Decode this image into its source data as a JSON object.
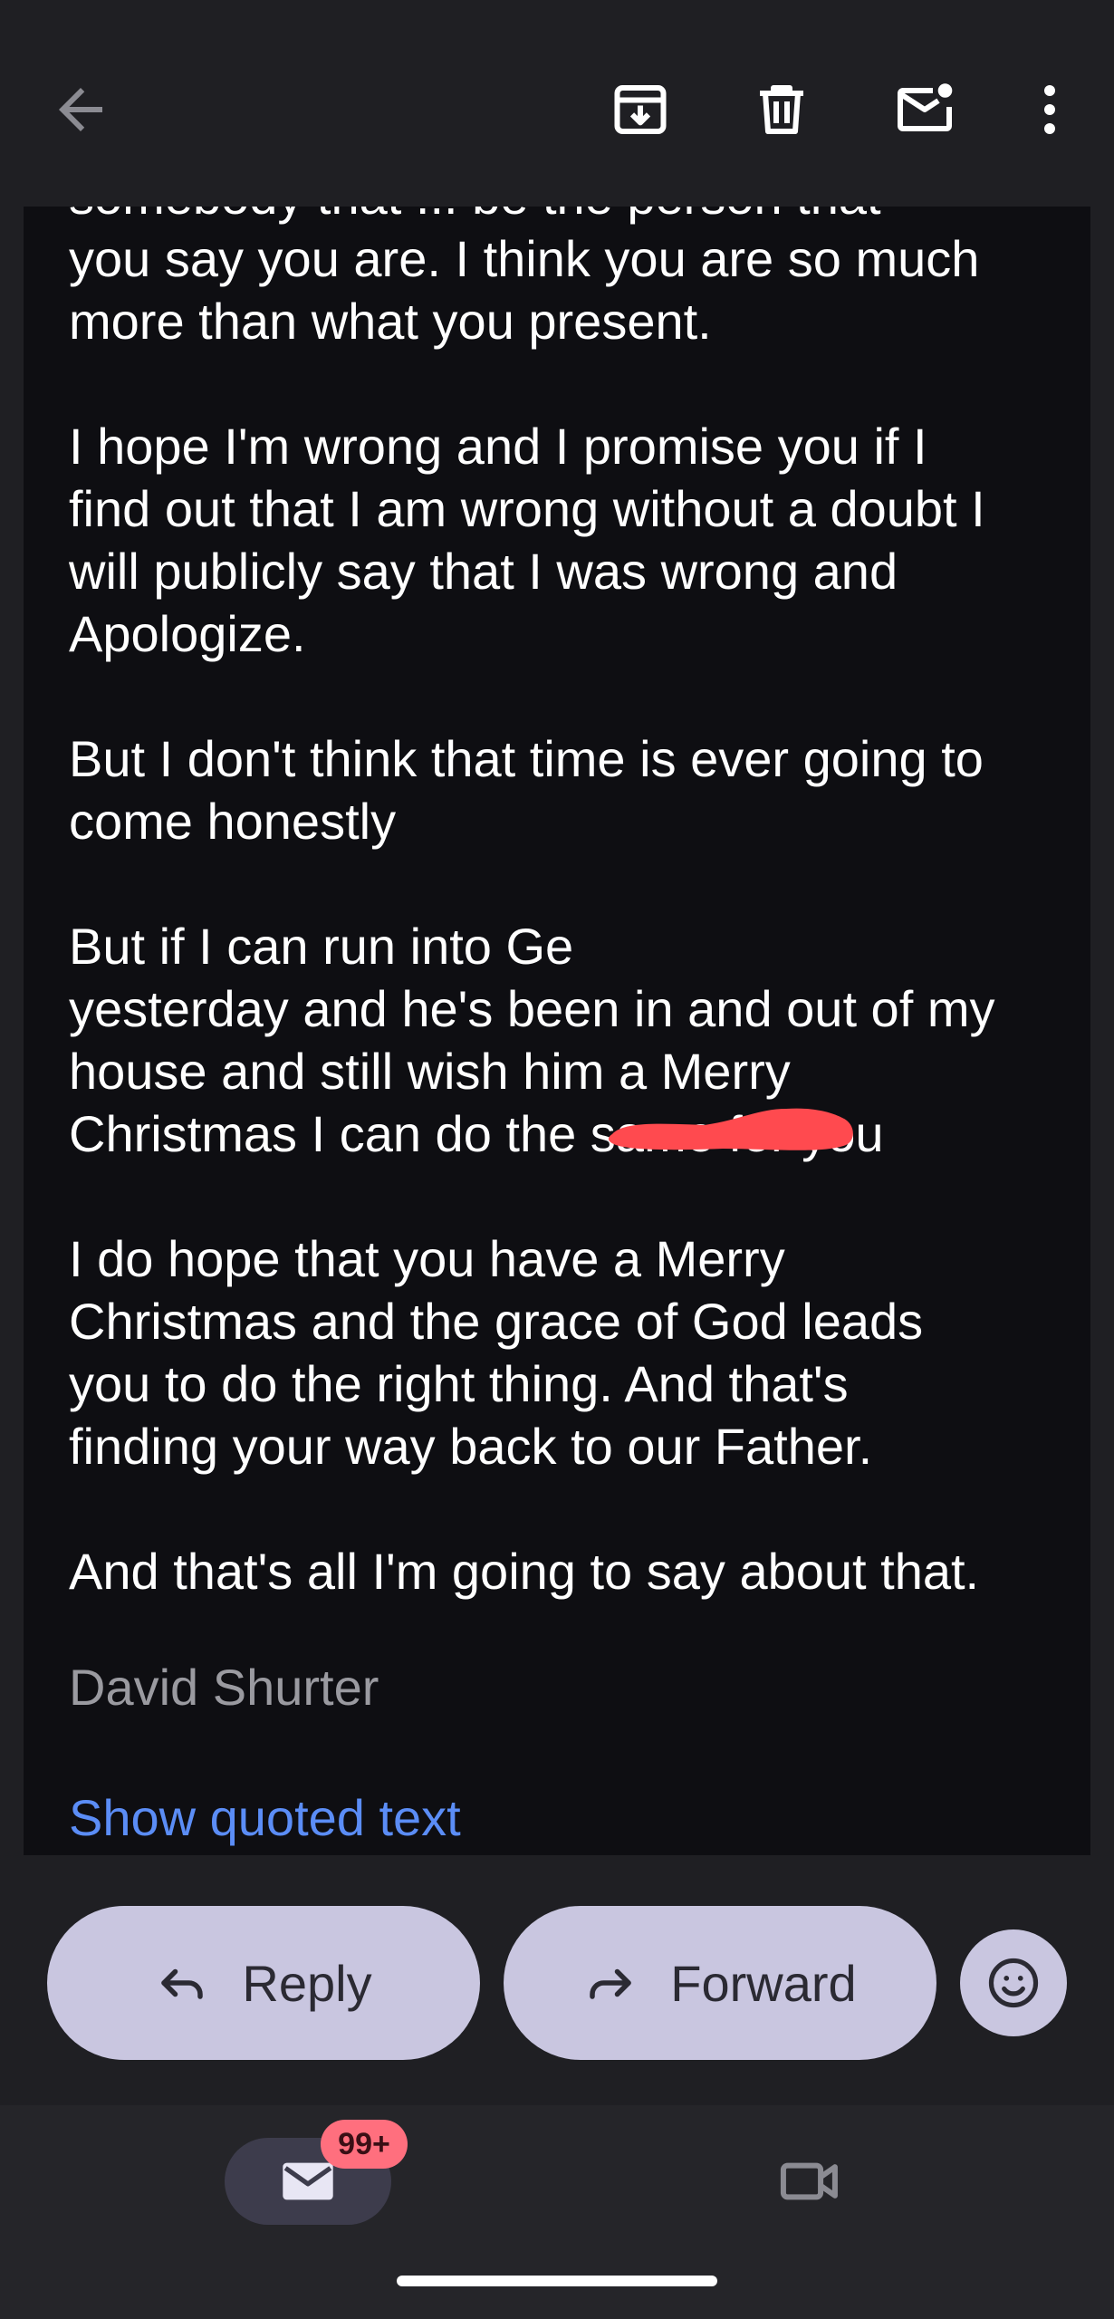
{
  "email": {
    "cut_line": "somebody that ... be the person that",
    "paragraphs": [
      [
        "you say you are. I think you are so much",
        "more than what you present."
      ],
      [
        "I hope I'm wrong and I promise you if I",
        "find out that I am wrong without a doubt I",
        "will publicly say that I was wrong and",
        "Apologize."
      ],
      [
        "But I don't think that time is ever going to",
        "come honestly"
      ],
      [
        "But if I can run into Ge",
        "yesterday and he's been in and out of my",
        "house and still wish him a Merry",
        "Christmas I can do the same for you"
      ],
      [
        "I do hope that you have a Merry",
        "Christmas and the grace of God leads",
        "you to do the right thing. And that's",
        "finding your way back to our Father."
      ],
      [
        "And that's all I'm going to say about that."
      ]
    ],
    "signature": "David Shurter",
    "show_quoted": "Show quoted text"
  },
  "actions": {
    "reply_label": "Reply",
    "forward_label": "Forward"
  },
  "nav": {
    "mail_badge": "99+"
  },
  "icons": {
    "back": "arrow-back-icon",
    "archive": "archive-icon",
    "delete": "trash-icon",
    "mark_unread": "mark-unread-icon",
    "more": "more-vertical-icon",
    "reply": "reply-arrow-icon",
    "forward": "forward-arrow-icon",
    "emoji": "emoji-smile-icon",
    "mail": "mail-icon",
    "meet": "video-camera-icon"
  },
  "colors": {
    "background": "#1f1f23",
    "email_body": "#0e0e12",
    "pill": "#c9c6e0",
    "link": "#5b8df6",
    "badge": "#ff6f7e",
    "redaction": "#ff4a4f"
  }
}
